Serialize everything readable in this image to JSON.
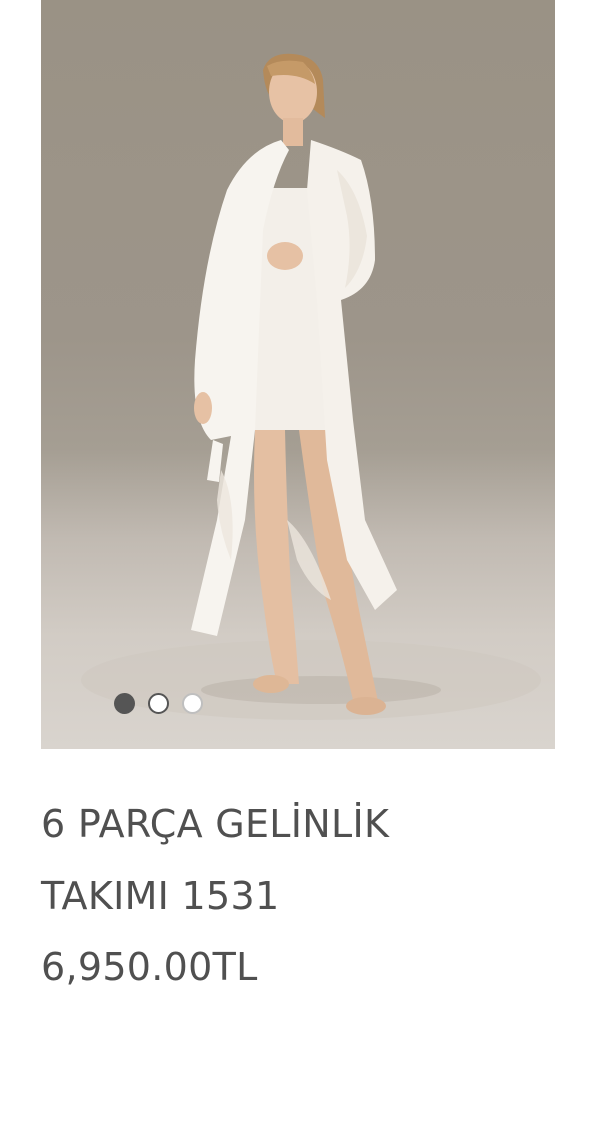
{
  "product": {
    "image_alt": "Model wearing white embroidered long robe over a short satin nightgown",
    "title_line_1": "6 PARÇA GELİNLİK",
    "title_line_2": "TAKIMI 1531",
    "price": "6,950.00TL"
  },
  "carousel": {
    "slide_count": 3,
    "active_index": 0
  },
  "colors": {
    "text": "#505050",
    "dot_active": "#555555",
    "dot_faded": "#bfbfbf",
    "backdrop": "#9d958a"
  }
}
